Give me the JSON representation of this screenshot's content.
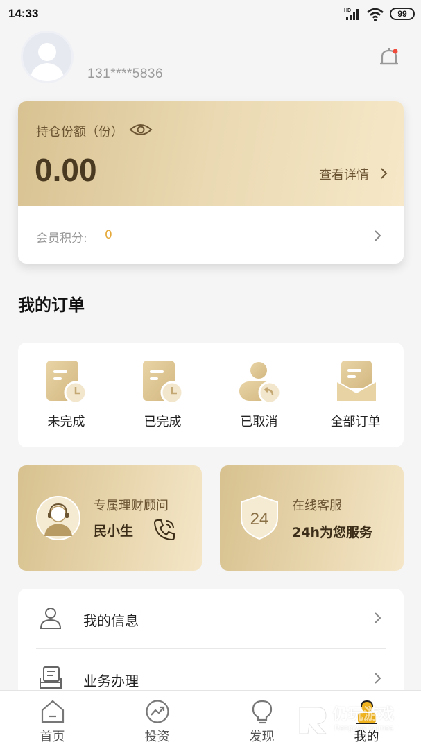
{
  "status_bar": {
    "time": "14:33",
    "battery": "99",
    "network": "HD"
  },
  "header": {
    "phone": "131****5836"
  },
  "holdings": {
    "label": "持仓份额（份）",
    "value": "0.00",
    "detail_link": "查看详情",
    "points_label": "会员积分:",
    "points_value": "0",
    "accent_color": "#e5a93a"
  },
  "orders": {
    "title": "我的订单",
    "items": [
      {
        "label": "未完成",
        "icon": "pending-order-icon"
      },
      {
        "label": "已完成",
        "icon": "completed-order-icon"
      },
      {
        "label": "已取消",
        "icon": "cancelled-order-icon"
      },
      {
        "label": "全部订单",
        "icon": "all-orders-icon"
      }
    ]
  },
  "services": {
    "advisor": {
      "title": "专属理财顾问",
      "name": "民小生"
    },
    "support": {
      "title": "在线客服",
      "subtitle": "24h为您服务",
      "badge": "24"
    }
  },
  "menu": {
    "items": [
      {
        "label": "我的信息",
        "icon": "user-icon"
      },
      {
        "label": "业务办理",
        "icon": "document-icon"
      }
    ]
  },
  "bottom_nav": {
    "items": [
      {
        "label": "首页",
        "icon": "home-icon"
      },
      {
        "label": "投资",
        "icon": "investment-icon"
      },
      {
        "label": "发现",
        "icon": "discover-icon"
      },
      {
        "label": "我的",
        "icon": "profile-icon",
        "active": true
      }
    ]
  },
  "watermark": {
    "text": "仍玩游戏",
    "sub": "Rengwan Games"
  }
}
